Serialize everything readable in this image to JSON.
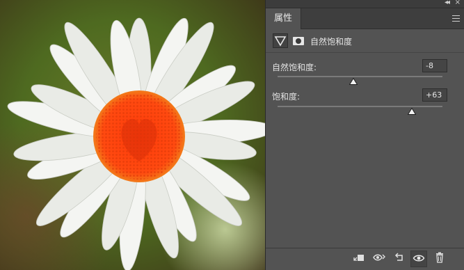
{
  "panel": {
    "tab_label": "属性",
    "adjustment_title": "自然饱和度",
    "vibrance": {
      "label": "自然饱和度:",
      "value": "-8",
      "min": -100,
      "max": 100
    },
    "saturation": {
      "label": "饱和度:",
      "value": "+63",
      "min": -100,
      "max": 100
    }
  },
  "photo": {
    "subject": "daisy-icon"
  },
  "icons": {
    "collapse": "double-chevron-left-icon",
    "close": "close-icon",
    "menu": "panel-menu-icon",
    "adjustment": "vibrance-triangle-icon",
    "mask": "layer-mask-icon",
    "clip": "clip-to-layer-icon",
    "view_previous": "view-previous-state-icon",
    "reset": "reset-icon",
    "visibility": "eye-icon",
    "delete": "trash-icon"
  }
}
